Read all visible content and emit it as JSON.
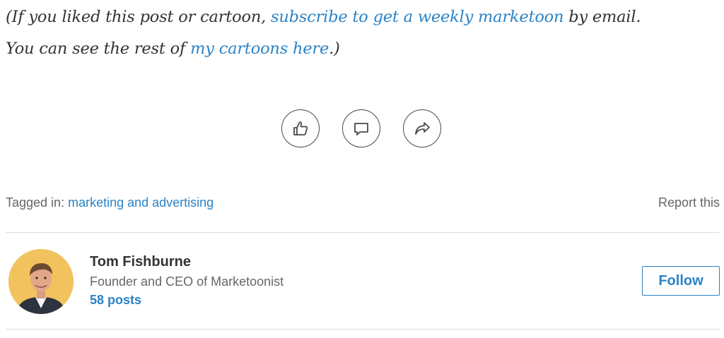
{
  "post": {
    "line1_pre": "(If you liked this post or cartoon, ",
    "subscribe_link": "subscribe to get a weekly marketoon",
    "line1_post": " by email.",
    "line2_pre": "You can see the rest of ",
    "cartoons_link": "my cartoons here",
    "line2_post": ".)"
  },
  "actions": [
    {
      "icon": "thumbs-up-icon",
      "label": "like"
    },
    {
      "icon": "comment-icon",
      "label": "comment"
    },
    {
      "icon": "share-icon",
      "label": "share"
    }
  ],
  "tags": {
    "prefix": "Tagged in: ",
    "link": "marketing and advertising"
  },
  "report_label": "Report this",
  "author": {
    "name": "Tom Fishburne",
    "title": "Founder and CEO of Marketoonist",
    "posts": "58 posts",
    "avatar": "author-avatar-photo"
  },
  "follow_label": "Follow",
  "colors": {
    "link": "#2b83c6",
    "text": "#333333",
    "muted": "#666666",
    "divider": "#dcdcdc",
    "avatar_bg": "#f2c25e"
  }
}
